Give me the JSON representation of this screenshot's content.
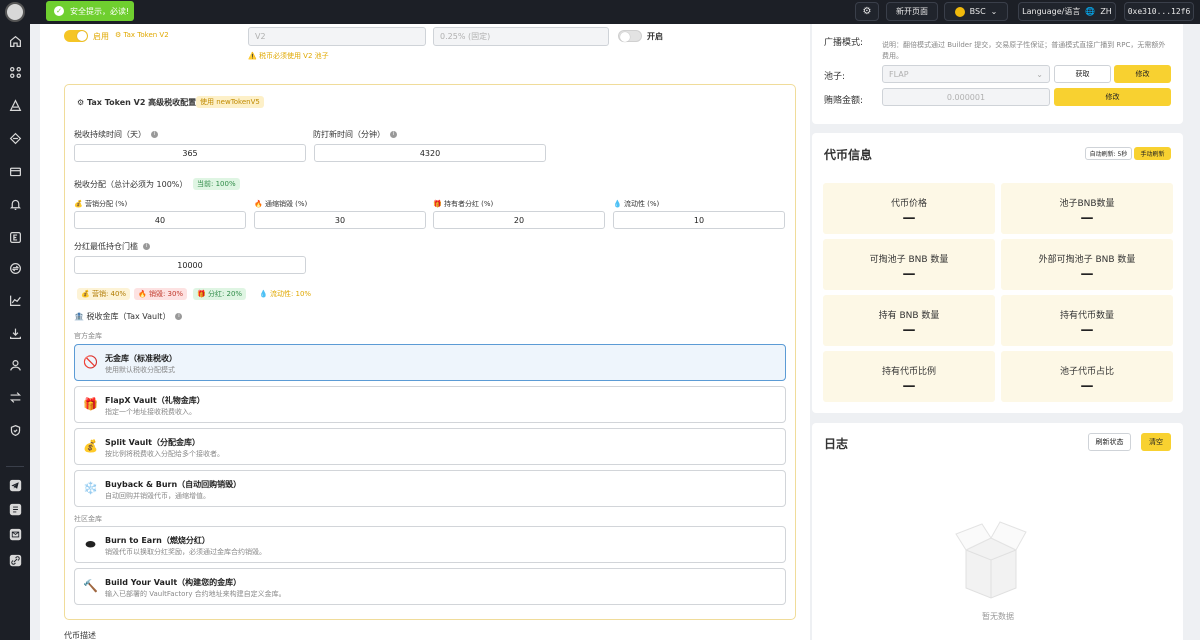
{
  "toast": {
    "text": "安全提示，必读!"
  },
  "topbar": {
    "new_page": "新开页面",
    "network": "BSC",
    "language_label": "Language/语言",
    "language_value": "ZH",
    "wallet": "0xe310...12f6"
  },
  "top_strip": {
    "enabled_label": "启用",
    "tax_token_label": "Tax Token V2",
    "version_value": "V2",
    "version_warning": "税币必须使用 V2 池子",
    "tax_rate_value": "0.25% (固定)",
    "switch_label": "开启"
  },
  "config": {
    "title": "Tax Token V2 高级税收配置",
    "badge": "使用 newTokenV5",
    "duration_label": "税收持续时间（天）",
    "duration_value": "365",
    "antisnipe_label": "防打新时间（分钟）",
    "antisnipe_value": "4320",
    "distribution_label": "税收分配（总计必须为 100%）",
    "current_badge": "当前: 100%",
    "fields": [
      {
        "icon": "💰",
        "label": "营销分配 (%)",
        "value": "40"
      },
      {
        "icon": "🔥",
        "label": "通缩销毁 (%)",
        "value": "30"
      },
      {
        "icon": "🎁",
        "label": "持有者分红 (%)",
        "value": "20"
      },
      {
        "icon": "💧",
        "label": "流动性 (%)",
        "value": "10"
      }
    ],
    "dividend_threshold_label": "分红最低持仓门槛",
    "dividend_threshold_value": "10000",
    "summary": [
      {
        "text": "💰 营销: 40%",
        "bg": "#fdf3d6",
        "color": "#b07a00"
      },
      {
        "text": "🔥 销毁: 30%",
        "bg": "#fde2e2",
        "color": "#c0392b"
      },
      {
        "text": "🎁 分红: 20%",
        "bg": "#dff5e3",
        "color": "#2e8b47"
      },
      {
        "text": "💧 流动性: 10%",
        "bg": "#ffffff",
        "color": "#e0a800"
      }
    ],
    "vault_label": "税收金库（Tax Vault）",
    "official_section": "官方金库",
    "community_section": "社区金库",
    "vaults": [
      {
        "icon": "🚫",
        "title": "无金库（标准税收）",
        "desc": "使用默认税收分配模式"
      },
      {
        "icon": "🎁",
        "title": "FlapX Vault（礼物金库）",
        "desc": "指定一个地址接收税费收入。"
      },
      {
        "icon": "💰",
        "title": "Split Vault（分配金库）",
        "desc": "按比例将税费收入分配给多个接收者。"
      },
      {
        "icon": "❄️",
        "title": "Buyback & Burn（自动回购销毁）",
        "desc": "自动回购并销毁代币，通缩增值。"
      },
      {
        "icon": "⬬",
        "title": "Burn to Earn（燃烧分红）",
        "desc": "销毁代币以换取分红奖励，必须通过金库合约销毁。"
      },
      {
        "icon": "🔨",
        "title": "Build Your Vault（构建您的金库）",
        "desc": "输入已部署的 VaultFactory 合约地址来构建自定义金库。"
      }
    ],
    "token_desc_label": "代币描述"
  },
  "broadcast": {
    "label": "广播模式:",
    "note": "说明：翻倍模式通过 Builder 提交，交易原子性保证；普通模式直接广播到 RPC，无需额外费用。",
    "pool_label": "池子:",
    "pool_value": "FLAP",
    "fetch_btn": "获取",
    "modify_btn": "修改",
    "bribe_label": "贿赂金额:",
    "bribe_value": "0.000001",
    "bribe_modify_btn": "修改"
  },
  "token_info": {
    "title": "代币信息",
    "auto_refresh": "自动刷新: 5秒",
    "manual_refresh": "手动刷新",
    "stats": [
      {
        "label": "代币价格",
        "value": "—"
      },
      {
        "label": "池子BNB数量",
        "value": "—"
      },
      {
        "label": "可掏池子 BNB 数量",
        "value": "—"
      },
      {
        "label": "外部可掏池子 BNB 数量",
        "value": "—"
      },
      {
        "label": "持有 BNB 数量",
        "value": "—"
      },
      {
        "label": "持有代币数量",
        "value": "—"
      },
      {
        "label": "持有代币比例",
        "value": "—"
      },
      {
        "label": "池子代币占比",
        "value": "—"
      }
    ]
  },
  "log": {
    "title": "日志",
    "refresh_btn": "刷新状态",
    "clear_btn": "清空",
    "empty": "暂无数据"
  },
  "colors": {
    "accent": "#f8d130",
    "dark": "#1c1f26",
    "toast": "#6fcf2f"
  }
}
